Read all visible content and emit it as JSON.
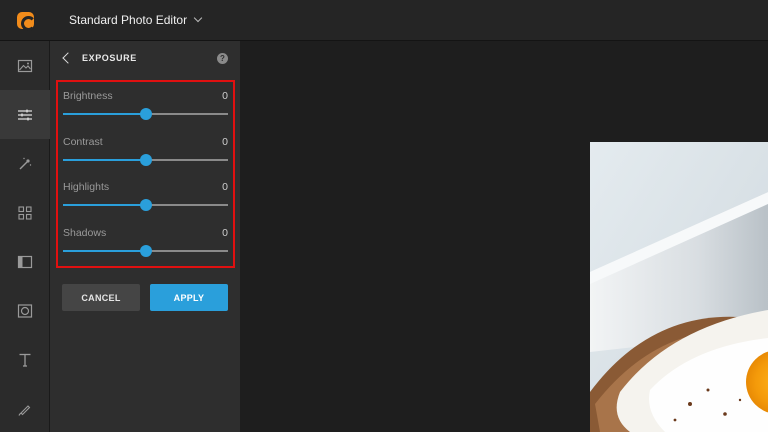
{
  "app": {
    "title": "Standard Photo Editor",
    "brand_color": "#f28c1b"
  },
  "toolbar": {
    "tools": [
      {
        "name": "image-icon"
      },
      {
        "name": "adjustments-icon",
        "active": true
      },
      {
        "name": "magic-wand-icon"
      },
      {
        "name": "grid-icon"
      },
      {
        "name": "frame-icon"
      },
      {
        "name": "vignette-icon"
      },
      {
        "name": "text-icon"
      },
      {
        "name": "brush-icon"
      }
    ]
  },
  "panel": {
    "title": "EXPOSURE",
    "accent_color": "#2a9fdb",
    "sliders": [
      {
        "label": "Brightness",
        "value": "0",
        "position_fraction": 0.5
      },
      {
        "label": "Contrast",
        "value": "0",
        "position_fraction": 0.5
      },
      {
        "label": "Highlights",
        "value": "0",
        "position_fraction": 0.5
      },
      {
        "label": "Shadows",
        "value": "0",
        "position_fraction": 0.5
      }
    ],
    "cancel_label": "CANCEL",
    "apply_label": "APPLY"
  }
}
